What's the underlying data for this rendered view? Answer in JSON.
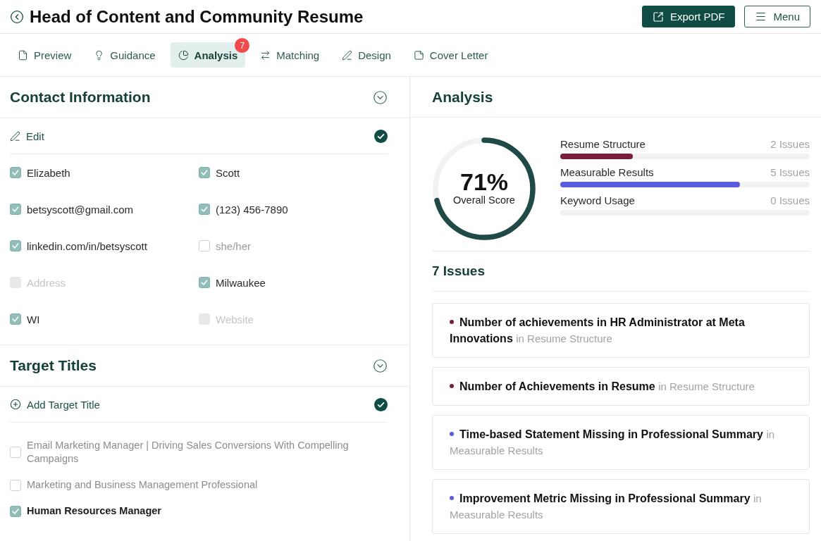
{
  "header": {
    "title": "Head of Content and Community Resume",
    "buttons": [
      {
        "kind": "primary",
        "label": "Export PDF"
      },
      {
        "kind": "outline",
        "label": "Menu"
      }
    ]
  },
  "tabs": [
    {
      "label": "Preview",
      "selected": false
    },
    {
      "label": "Guidance",
      "selected": false
    },
    {
      "label": "Analysis",
      "selected": true,
      "badge": "7"
    },
    {
      "label": "Matching",
      "selected": false
    },
    {
      "label": "Design",
      "selected": false
    },
    {
      "label": "Cover Letter",
      "selected": false
    }
  ],
  "contact_information": {
    "title": "Contact Information",
    "action": "Edit",
    "done": true,
    "fields": [
      {
        "label": "Elizabeth",
        "checked": true,
        "disabled": false
      },
      {
        "label": "Scott",
        "checked": true,
        "disabled": false
      },
      {
        "label": "betsyscott@gmail.com",
        "checked": true,
        "disabled": false
      },
      {
        "label": "(123) 456-7890",
        "checked": true,
        "disabled": false
      },
      {
        "label": "linkedin.com/in/betsyscott",
        "checked": true,
        "disabled": false
      },
      {
        "label": "she/her",
        "checked": false,
        "disabled": false
      },
      {
        "label": "Address",
        "checked": false,
        "disabled": true
      },
      {
        "label": "Milwaukee",
        "checked": true,
        "disabled": false
      },
      {
        "label": "WI",
        "checked": true,
        "disabled": false
      },
      {
        "label": "Website",
        "checked": false,
        "disabled": true
      }
    ]
  },
  "target_titles": {
    "title": "Target Titles",
    "action": "Add Target Title",
    "done": true,
    "items": [
      {
        "label": "Email Marketing Manager | Driving Sales Conversions With Compelling Campaigns",
        "checked": false
      },
      {
        "label": "Marketing and Business Management Professional",
        "checked": false
      },
      {
        "label": "Human Resources Manager",
        "checked": true
      }
    ]
  },
  "analysis": {
    "title": "Analysis",
    "score": {
      "value": "71%",
      "label": "Overall Score",
      "level": 0.71
    },
    "categories": [
      {
        "name": "Resume Structure",
        "issues": "2 Issues",
        "level": 0.29,
        "color": "#7a1c3e"
      },
      {
        "name": "Measurable Results",
        "issues": "5 Issues",
        "level": 0.72,
        "color": "#5b5be0"
      },
      {
        "name": "Keyword Usage",
        "issues": "0 Issues",
        "level": 0
      }
    ]
  },
  "issues": {
    "heading": "7 Issues",
    "items": [
      {
        "title": "Number of achievements in HR Administrator at Meta Innovations",
        "section": "in Resume Structure",
        "color": "#7a1c3e"
      },
      {
        "title": "Number of Achievements in Resume",
        "section": "in Resume Structure",
        "color": "#7a1c3e"
      },
      {
        "title": "Time-based Statement Missing in Professional Summary",
        "section": "in Measurable Results",
        "color": "#5b5be0"
      },
      {
        "title": "Improvement Metric Missing in Professional Summary",
        "section": "in Measurable Results",
        "color": "#5b5be0"
      }
    ]
  }
}
